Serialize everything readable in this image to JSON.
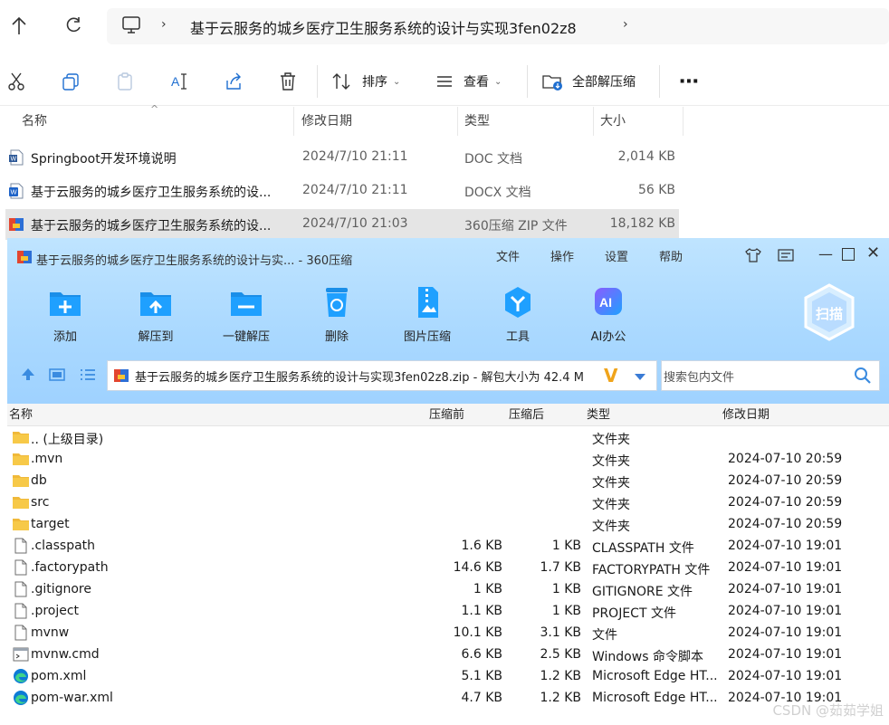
{
  "explorer": {
    "breadcrumb": "基于云服务的城乡医疗卫生服务系统的设计与实现3fen02z8",
    "toolbar": {
      "sort_label": "排序",
      "view_label": "查看",
      "extract_all_label": "全部解压缩"
    },
    "columns": {
      "name": "名称",
      "date": "修改日期",
      "type": "类型",
      "size": "大小"
    },
    "files": [
      {
        "name": "Springboot开发环境说明",
        "date": "2024/7/10 21:11",
        "type": "DOC 文档",
        "size": "2,014 KB",
        "icon": "word-doc-icon"
      },
      {
        "name": "基于云服务的城乡医疗卫生服务系统的设...",
        "date": "2024/7/10 21:11",
        "type": "DOCX 文档",
        "size": "56 KB",
        "icon": "word-docx-icon"
      },
      {
        "name": "基于云服务的城乡医疗卫生服务系统的设...",
        "date": "2024/7/10 21:03",
        "type": "360压缩 ZIP 文件",
        "size": "18,182 KB",
        "icon": "zip-archive-icon",
        "selected": true
      }
    ]
  },
  "zip_window": {
    "title": "基于云服务的城乡医疗卫生服务系统的设计与实... - 360压缩",
    "menus": [
      "文件",
      "操作",
      "设置",
      "帮助"
    ],
    "tools": [
      {
        "label": "添加",
        "icon": "add-to-archive-icon"
      },
      {
        "label": "解压到",
        "icon": "extract-to-icon"
      },
      {
        "label": "一键解压",
        "icon": "one-click-extract-icon"
      },
      {
        "label": "删除",
        "icon": "delete-icon"
      },
      {
        "label": "图片压缩",
        "icon": "image-compress-icon"
      },
      {
        "label": "工具",
        "icon": "tools-icon"
      },
      {
        "label": "AI办公",
        "icon": "ai-office-icon"
      }
    ],
    "scan_label": "扫描",
    "path_text": "基于云服务的城乡医疗卫生服务系统的设计与实现3fen02z8.zip - 解包大小为 42.4 M",
    "search_placeholder": "搜索包内文件",
    "columns": {
      "name": "名称",
      "before": "压缩前",
      "after": "压缩后",
      "type": "类型",
      "date": "修改日期"
    },
    "entries": [
      {
        "name": ".. (上级目录)",
        "before": "",
        "after": "",
        "type": "文件夹",
        "date": "",
        "icon": "folder-icon"
      },
      {
        "name": ".mvn",
        "before": "",
        "after": "",
        "type": "文件夹",
        "date": "2024-07-10 20:59",
        "icon": "folder-icon"
      },
      {
        "name": "db",
        "before": "",
        "after": "",
        "type": "文件夹",
        "date": "2024-07-10 20:59",
        "icon": "folder-icon"
      },
      {
        "name": "src",
        "before": "",
        "after": "",
        "type": "文件夹",
        "date": "2024-07-10 20:59",
        "icon": "folder-icon"
      },
      {
        "name": "target",
        "before": "",
        "after": "",
        "type": "文件夹",
        "date": "2024-07-10 20:59",
        "icon": "folder-icon"
      },
      {
        "name": ".classpath",
        "before": "1.6 KB",
        "after": "1 KB",
        "type": "CLASSPATH 文件",
        "date": "2024-07-10 19:01",
        "icon": "file-icon"
      },
      {
        "name": ".factorypath",
        "before": "14.6 KB",
        "after": "1.7 KB",
        "type": "FACTORYPATH 文件",
        "date": "2024-07-10 19:01",
        "icon": "file-icon"
      },
      {
        "name": ".gitignore",
        "before": "1 KB",
        "after": "1 KB",
        "type": "GITIGNORE 文件",
        "date": "2024-07-10 19:01",
        "icon": "file-icon"
      },
      {
        "name": ".project",
        "before": "1.1 KB",
        "after": "1 KB",
        "type": "PROJECT 文件",
        "date": "2024-07-10 19:01",
        "icon": "file-icon"
      },
      {
        "name": "mvnw",
        "before": "10.1 KB",
        "after": "3.1 KB",
        "type": "文件",
        "date": "2024-07-10 19:01",
        "icon": "file-icon"
      },
      {
        "name": "mvnw.cmd",
        "before": "6.6 KB",
        "after": "2.5 KB",
        "type": "Windows 命令脚本",
        "date": "2024-07-10 19:01",
        "icon": "cmd-script-icon"
      },
      {
        "name": "pom.xml",
        "before": "5.1 KB",
        "after": "1.2 KB",
        "type": "Microsoft Edge HT...",
        "date": "2024-07-10 19:01",
        "icon": "edge-icon"
      },
      {
        "name": "pom-war.xml",
        "before": "4.7 KB",
        "after": "1.2 KB",
        "type": "Microsoft Edge HT...",
        "date": "2024-07-10 19:01",
        "icon": "edge-icon"
      }
    ]
  },
  "watermark": "CSDN @茹茹学姐"
}
